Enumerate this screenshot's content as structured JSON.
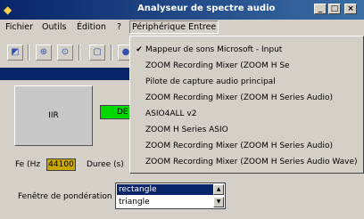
{
  "window": {
    "title": "Analyseur de spectre audio",
    "icon": "app-icon",
    "controls": {
      "minimize": "_",
      "maximize": "□",
      "close": "×"
    }
  },
  "menubar": {
    "items": [
      "Fichier",
      "Outils",
      "Édition",
      "?",
      "Périphérique Entree"
    ]
  },
  "toolbar": {
    "icons": [
      "equalizer-icon",
      "zoom-in-icon",
      "zoom-out-icon",
      "panel-icon"
    ]
  },
  "main": {
    "iir_button": "IIR",
    "green_button": "DE",
    "fe_label": "Fe (Hz",
    "fe_value": "44100",
    "duree_label": "Duree (s)",
    "fenetre_label": "Fenêtre de pondération",
    "window_list": {
      "items": [
        "rectangle",
        "triangle"
      ],
      "selected": "rectangle"
    }
  },
  "dropdown": {
    "items": [
      {
        "label": "Mappeur de sons Microsoft - Input",
        "checked": true
      },
      {
        "label": "ZOOM Recording Mixer (ZOOM H Se",
        "checked": false
      },
      {
        "label": "Pilote de capture audio principal",
        "checked": false
      },
      {
        "label": "ZOOM Recording Mixer (ZOOM H Series Audio)",
        "checked": false
      },
      {
        "label": "ASIO4ALL v2",
        "checked": false
      },
      {
        "label": "ZOOM H Series ASIO",
        "checked": false
      },
      {
        "label": "ZOOM Recording Mixer (ZOOM H Series Audio)",
        "checked": false
      },
      {
        "label": "ZOOM Recording Mixer (ZOOM H Series Audio Wave)",
        "checked": false
      }
    ]
  },
  "colors": {
    "titlebar": "#0a246a",
    "green_button": "#00d800",
    "fe_value_bg": "#c8a800",
    "selection": "#0a246a"
  }
}
